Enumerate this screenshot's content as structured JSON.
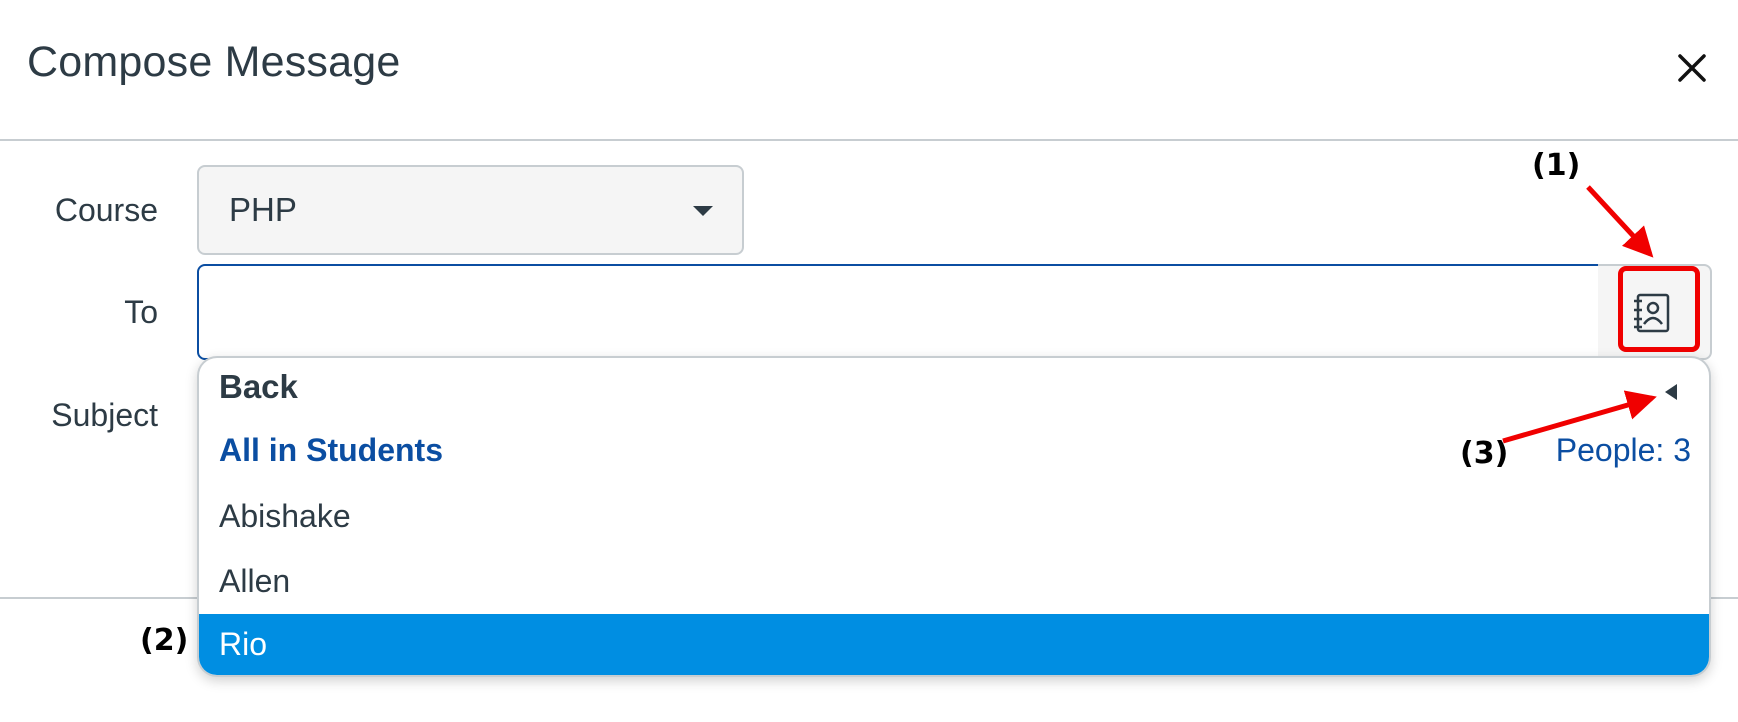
{
  "dialog": {
    "title": "Compose Message",
    "close_icon": "close-icon"
  },
  "form": {
    "course_label": "Course",
    "course_value": "PHP",
    "to_label": "To",
    "to_value": "",
    "subject_label": "Subject",
    "address_book_icon": "address-book-icon"
  },
  "dropdown": {
    "back_label": "Back",
    "group_label": "All in Students",
    "people_count": "People: 3",
    "items": [
      {
        "label": "Abishake",
        "selected": false
      },
      {
        "label": "Allen",
        "selected": false
      },
      {
        "label": "Rio",
        "selected": true
      }
    ]
  },
  "annotations": {
    "callout_1": "(1)",
    "callout_2": "(2)",
    "callout_3": "(3)",
    "color": "#f00000"
  },
  "colors": {
    "link_blue": "#0b4ea2",
    "selected_bg": "#008ee2",
    "text": "#2d3b45"
  }
}
